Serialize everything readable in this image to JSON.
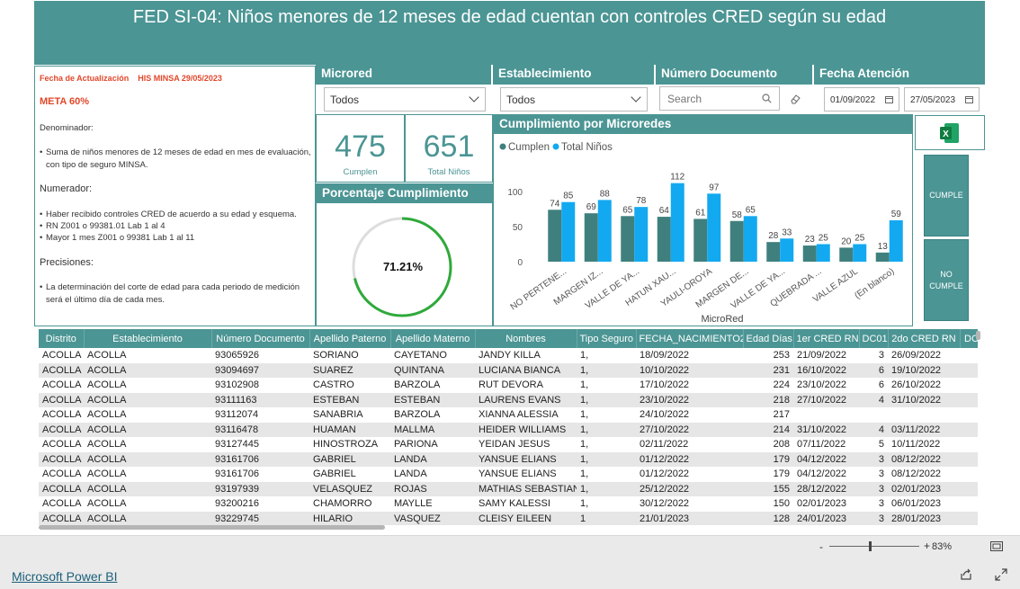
{
  "report": {
    "title": "FED SI-04: Niños menores de 12 meses de edad cuentan con controles CRED según su edad"
  },
  "info": {
    "update_label": "Fecha de Actualización",
    "update_value": "HIS MINSA  29/05/2023",
    "meta": "META  60%",
    "denominador_title": "Denominador:",
    "denominador_items": [
      "Suma de niños menores de 12 meses de edad en mes de evaluación, con tipo de seguro MINSA."
    ],
    "numerador_title": "Numerador:",
    "numerador_items": [
      "Haber recibido controles CRED de acuerdo a su edad y esquema.",
      "RN Z001 o 99381.01 Lab 1 al 4",
      "Mayor 1 mes Z001 o 99381 Lab 1 al 11"
    ],
    "precisiones_title": "Precisiones:",
    "precisiones_items": [
      "La determinación del corte de edad para cada periodo de medición será el último día de cada mes."
    ]
  },
  "filters": {
    "microred": {
      "label": "Microred",
      "value": "Todos"
    },
    "establecimiento": {
      "label": "Establecimiento",
      "value": "Todos"
    },
    "documento": {
      "label": "Número Documento",
      "placeholder": "Search"
    },
    "fecha": {
      "label": "Fecha Atención",
      "from": "01/09/2022",
      "to": "27/05/2023"
    }
  },
  "cards": {
    "cumplen": {
      "value": "475",
      "label": "Cumplen"
    },
    "total": {
      "value": "651",
      "label": "Total Niños"
    }
  },
  "gauge": {
    "title": "Porcentaje Cumplimiento",
    "value_text": "71.21%",
    "fraction": 0.7121
  },
  "buttons": {
    "cumple": "CUMPLE",
    "no_cumple_1": "NO",
    "no_cumple_2": "CUMPLE"
  },
  "colors": {
    "teal": "#4b9594",
    "cumplen": "#3f807e",
    "total": "#13a9f0",
    "accent": "#e2472a"
  },
  "chart_data": {
    "type": "bar",
    "title": "Cumplimiento por Microredes",
    "xlabel": "MicroRed",
    "ylabel": "",
    "ylim": [
      0,
      120
    ],
    "yticks": [
      0,
      50,
      100
    ],
    "legend_position": "top-left",
    "categories": [
      "NO PERTENE...",
      "MARGEN IZ...",
      "VALLE DE YA...",
      "HATUN XAU...",
      "YAULI-OROYA",
      "MARGEN DE...",
      "VALLE DE YA...",
      "QUEBRADA ...",
      "VALLE AZUL",
      "(En blanco)"
    ],
    "series": [
      {
        "name": "Cumplen",
        "color": "#3f807e",
        "values": [
          74,
          69,
          65,
          64,
          61,
          58,
          28,
          23,
          20,
          13
        ]
      },
      {
        "name": "Total Niños",
        "color": "#13a9f0",
        "values": [
          85,
          88,
          78,
          112,
          97,
          65,
          33,
          25,
          25,
          59
        ]
      }
    ]
  },
  "table": {
    "columns": [
      "Distrito",
      "Establecimiento",
      "Número Documento",
      "Apellido Paterno",
      "Apellido Materno",
      "Nombres",
      "Tipo Seguro",
      "FECHA_NACIMIENTO2",
      "Edad Días",
      "1er CRED RN",
      "DC01",
      "2do CRED RN",
      "DC"
    ],
    "rows": [
      [
        "ACOLLA",
        "ACOLLA",
        "93065926",
        "SORIANO",
        "CAYETANO",
        "JANDY KILLA",
        "1,",
        "18/09/2022",
        "253",
        "21/09/2022",
        "3",
        "26/09/2022",
        ""
      ],
      [
        "ACOLLA",
        "ACOLLA",
        "93094697",
        "SUAREZ",
        "QUINTANA",
        "LUCIANA BIANCA",
        "1,",
        "10/10/2022",
        "231",
        "16/10/2022",
        "6",
        "19/10/2022",
        ""
      ],
      [
        "ACOLLA",
        "ACOLLA",
        "93102908",
        "CASTRO",
        "BARZOLA",
        "RUT DEVORA",
        "1,",
        "17/10/2022",
        "224",
        "23/10/2022",
        "6",
        "26/10/2022",
        ""
      ],
      [
        "ACOLLA",
        "ACOLLA",
        "93111163",
        "ESTEBAN",
        "ESTEBAN",
        "LAURENS EVANS",
        "1,",
        "23/10/2022",
        "218",
        "27/10/2022",
        "4",
        "31/10/2022",
        ""
      ],
      [
        "ACOLLA",
        "ACOLLA",
        "93112074",
        "SANABRIA",
        "BARZOLA",
        "XIANNA ALESSIA",
        "1,",
        "24/10/2022",
        "217",
        "",
        "",
        "",
        ""
      ],
      [
        "ACOLLA",
        "ACOLLA",
        "93116478",
        "HUAMAN",
        "MALLMA",
        "HEIDER WILLIAMS",
        "1,",
        "27/10/2022",
        "214",
        "31/10/2022",
        "4",
        "03/11/2022",
        ""
      ],
      [
        "ACOLLA",
        "ACOLLA",
        "93127445",
        "HINOSTROZA",
        "PARIONA",
        "YEIDAN JESUS",
        "1,",
        "02/11/2022",
        "208",
        "07/11/2022",
        "5",
        "10/11/2022",
        ""
      ],
      [
        "ACOLLA",
        "ACOLLA",
        "93161706",
        "GABRIEL",
        "LANDA",
        "YANSUE ELIANS",
        "1,",
        "01/12/2022",
        "179",
        "04/12/2022",
        "3",
        "08/12/2022",
        ""
      ],
      [
        "ACOLLA",
        "ACOLLA",
        "93161706",
        "GABRIEL",
        "LANDA",
        "YANSUE ELIANS",
        "1,",
        "01/12/2022",
        "179",
        "04/12/2022",
        "3",
        "08/12/2022",
        ""
      ],
      [
        "ACOLLA",
        "ACOLLA",
        "93197939",
        "VELASQUEZ",
        "ROJAS",
        "MATHIAS SEBASTIAN",
        "1,",
        "25/12/2022",
        "155",
        "28/12/2022",
        "3",
        "02/01/2023",
        ""
      ],
      [
        "ACOLLA",
        "ACOLLA",
        "93200216",
        "CHAMORRO",
        "MAYLLE",
        "SAMY KALESSI",
        "1,",
        "30/12/2022",
        "150",
        "02/01/2023",
        "3",
        "06/01/2023",
        ""
      ],
      [
        "ACOLLA",
        "ACOLLA",
        "93229745",
        "HILARIO",
        "VASQUEZ",
        "CLEISY EILEEN",
        "1",
        "21/01/2023",
        "128",
        "24/01/2023",
        "3",
        "28/01/2023",
        ""
      ]
    ]
  },
  "footer": {
    "zoom_minus": "-",
    "zoom_plus": "+",
    "zoom_level": "83%",
    "zoom_fraction": 0.45,
    "brand": "Microsoft Power BI"
  }
}
